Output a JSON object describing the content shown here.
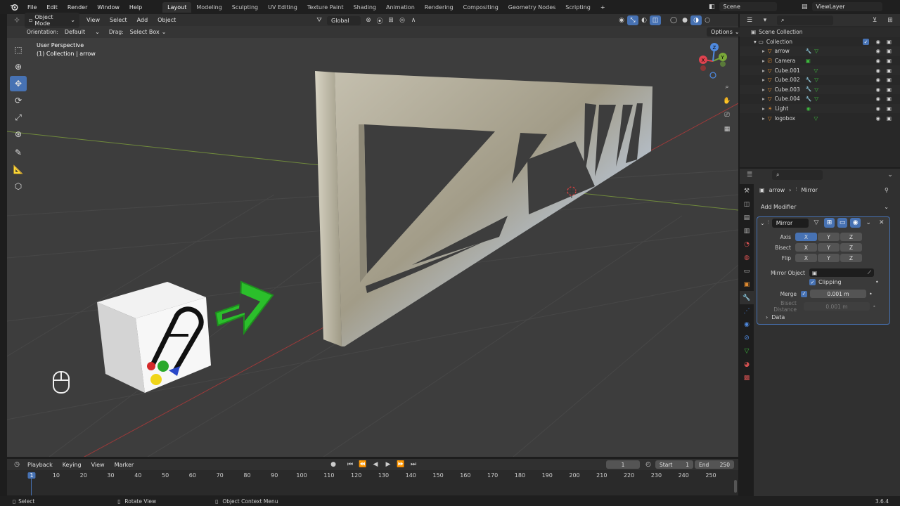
{
  "menu": {
    "items": [
      "File",
      "Edit",
      "Render",
      "Window",
      "Help"
    ],
    "workspaces": [
      "Layout",
      "Modeling",
      "Sculpting",
      "UV Editing",
      "Texture Paint",
      "Shading",
      "Animation",
      "Rendering",
      "Compositing",
      "Geometry Nodes",
      "Scripting"
    ],
    "active_workspace": "Layout",
    "add_tab": "+",
    "scene": "Scene",
    "view_layer": "ViewLayer"
  },
  "viewport_header": {
    "mode": "Object Mode",
    "menus": [
      "View",
      "Select",
      "Add",
      "Object"
    ],
    "transform_space": "Global",
    "options": "Options"
  },
  "viewport_sub": {
    "orientation_label": "Orientation:",
    "orientation_value": "Default",
    "drag_label": "Drag:",
    "drag_value": "Select Box"
  },
  "viewport": {
    "perspective": "User Perspective",
    "collection_info": "(1) Collection | arrow",
    "gizmo_axes": [
      "X",
      "Y",
      "Z"
    ]
  },
  "outliner": {
    "root": "Scene Collection",
    "collection": "Collection",
    "items": [
      {
        "name": "arrow",
        "type": "mesh"
      },
      {
        "name": "Camera",
        "type": "camera"
      },
      {
        "name": "Cube.001",
        "type": "mesh"
      },
      {
        "name": "Cube.002",
        "type": "mesh"
      },
      {
        "name": "Cube.003",
        "type": "mesh"
      },
      {
        "name": "Cube.004",
        "type": "mesh"
      },
      {
        "name": "Light",
        "type": "light"
      },
      {
        "name": "logobox",
        "type": "mesh"
      }
    ]
  },
  "properties": {
    "breadcrumb_object": "arrow",
    "breadcrumb_modifier": "Mirror",
    "add_modifier": "Add Modifier",
    "modifier_name": "Mirror",
    "axis_label": "Axis",
    "bisect_label": "Bisect",
    "flip_label": "Flip",
    "axes": [
      "X",
      "Y",
      "Z"
    ],
    "mirror_object_label": "Mirror Object",
    "clipping_label": "Clipping",
    "merge_label": "Merge",
    "merge_value": "0.001 m",
    "bisect_distance_label": "Bisect Distance",
    "bisect_distance_value": "0.001 m",
    "data_label": "Data"
  },
  "timeline": {
    "menus": [
      "Playback",
      "Keying",
      "View",
      "Marker"
    ],
    "current_frame": "1",
    "start_label": "Start",
    "start_value": "1",
    "end_label": "End",
    "end_value": "250",
    "ticks": [
      "1",
      "10",
      "20",
      "30",
      "40",
      "50",
      "60",
      "70",
      "80",
      "90",
      "100",
      "110",
      "120",
      "130",
      "140",
      "150",
      "160",
      "170",
      "180",
      "190",
      "200",
      "210",
      "220",
      "230",
      "240",
      "250"
    ]
  },
  "statusbar": {
    "select": "Select",
    "rotate": "Rotate View",
    "context": "Object Context Menu",
    "version": "3.6.4"
  },
  "colors": {
    "accent": "#4772b3",
    "arrow_green": "#2bb92b",
    "truss": "#a8a290",
    "axis_x": "#e0434f",
    "axis_y": "#7aa839",
    "axis_z": "#4f8ae0"
  }
}
